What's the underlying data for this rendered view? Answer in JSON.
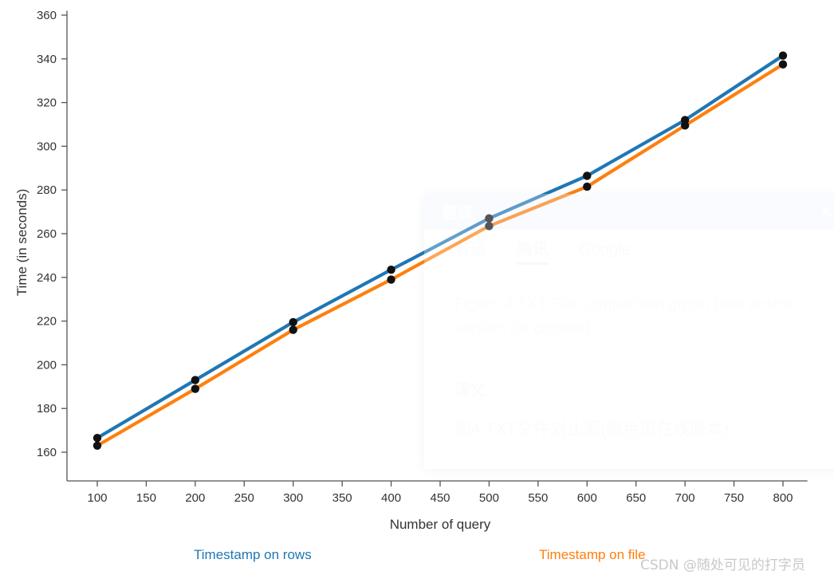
{
  "chart_data": {
    "type": "line",
    "title": "",
    "xlabel": "Number of query",
    "ylabel": "Time (in seconds)",
    "x": [
      100,
      200,
      300,
      400,
      500,
      600,
      700,
      800
    ],
    "xlim": [
      75,
      825
    ],
    "ylim": [
      150,
      362
    ],
    "xticks": [
      100,
      150,
      200,
      250,
      300,
      350,
      400,
      450,
      500,
      550,
      600,
      650,
      700,
      750,
      800
    ],
    "yticks": [
      160,
      180,
      200,
      220,
      240,
      260,
      280,
      300,
      320,
      340,
      360
    ],
    "grid": false,
    "legend_position": "below",
    "series": [
      {
        "name": "Timestamp on rows",
        "color": "#1f77b4",
        "values": [
          166.5,
          193,
          219.5,
          243.5,
          267,
          286.5,
          312,
          341.5
        ]
      },
      {
        "name": "Timestamp on file",
        "color": "#ff7f0e",
        "values": [
          163,
          189,
          216,
          239,
          263.5,
          281.5,
          309.5,
          337.5
        ]
      }
    ],
    "marker_color": "#111111"
  },
  "legend": {
    "items": [
      {
        "label": "Timestamp on rows",
        "color": "#1f77b4"
      },
      {
        "label": "Timestamp on file",
        "color": "#ff7f0e"
      }
    ]
  },
  "watermark": {
    "text": "CSDN @随处可见的打字员"
  },
  "translate_panel": {
    "title": "翻译",
    "close_icon": "close-icon",
    "tabs": [
      {
        "label": "有道",
        "active": false
      },
      {
        "label": "腾讯",
        "active": true
      },
      {
        "label": "Google",
        "active": false
      }
    ],
    "source_text": "Figure 4 TXT File comparison graph (see online version for colours)",
    "result_label": "译文",
    "translated_text": "图4 TXT文件对比图(颜色见在线版本)"
  }
}
